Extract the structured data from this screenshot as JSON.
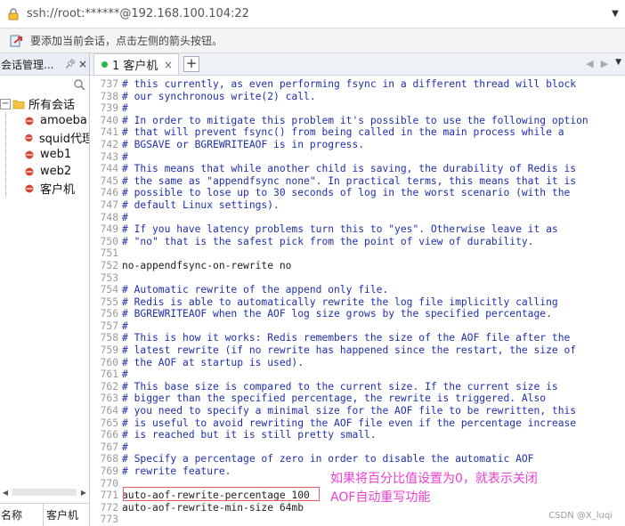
{
  "address_bar": {
    "text": "ssh://root:******@192.168.100.104:22",
    "dropdown_icon": "chevron-down-icon"
  },
  "hint_bar": {
    "text": "要添加当前会话，点击左侧的箭头按钮。"
  },
  "sidebar": {
    "title": "会话管理...",
    "pin_icon": "pin-icon",
    "close_icon": "close-icon",
    "root": {
      "toggle": "−",
      "label": "所有会话"
    },
    "items": [
      {
        "label": "amoeba"
      },
      {
        "label": "squid代理"
      },
      {
        "label": "web1"
      },
      {
        "label": "web2"
      },
      {
        "label": "客户机"
      }
    ],
    "footer": {
      "col1": "名称",
      "col2": "客户机"
    }
  },
  "tabs": [
    {
      "label": "1 客户机",
      "active": true
    }
  ],
  "tab_add": "+",
  "terminal": {
    "lines": [
      {
        "n": "737",
        "t": "# this currently, as even performing fsync in a different thread will block",
        "c": "comment"
      },
      {
        "n": "738",
        "t": "# our synchronous write(2) call.",
        "c": "comment"
      },
      {
        "n": "739",
        "t": "#",
        "c": "comment"
      },
      {
        "n": "740",
        "t": "# In order to mitigate this problem it's possible to use the following option",
        "c": "comment"
      },
      {
        "n": "741",
        "t": "# that will prevent fsync() from being called in the main process while a",
        "c": "comment"
      },
      {
        "n": "742",
        "t": "# BGSAVE or BGREWRITEAOF is in progress.",
        "c": "comment"
      },
      {
        "n": "743",
        "t": "#",
        "c": "comment"
      },
      {
        "n": "744",
        "t": "# This means that while another child is saving, the durability of Redis is",
        "c": "comment"
      },
      {
        "n": "745",
        "t": "# the same as \"appendfsync none\". In practical terms, this means that it is",
        "c": "comment"
      },
      {
        "n": "746",
        "t": "# possible to lose up to 30 seconds of log in the worst scenario (with the",
        "c": "comment"
      },
      {
        "n": "747",
        "t": "# default Linux settings).",
        "c": "comment"
      },
      {
        "n": "748",
        "t": "#",
        "c": "comment"
      },
      {
        "n": "749",
        "t": "# If you have latency problems turn this to \"yes\". Otherwise leave it as",
        "c": "comment"
      },
      {
        "n": "750",
        "t": "# \"no\" that is the safest pick from the point of view of durability.",
        "c": "comment"
      },
      {
        "n": "751",
        "t": "",
        "c": "code"
      },
      {
        "n": "752",
        "t": "no-appendfsync-on-rewrite no",
        "c": "code"
      },
      {
        "n": "753",
        "t": "",
        "c": "code"
      },
      {
        "n": "754",
        "t": "# Automatic rewrite of the append only file.",
        "c": "comment"
      },
      {
        "n": "755",
        "t": "# Redis is able to automatically rewrite the log file implicitly calling",
        "c": "comment"
      },
      {
        "n": "756",
        "t": "# BGREWRITEAOF when the AOF log size grows by the specified percentage.",
        "c": "comment"
      },
      {
        "n": "757",
        "t": "#",
        "c": "comment"
      },
      {
        "n": "758",
        "t": "# This is how it works: Redis remembers the size of the AOF file after the",
        "c": "comment"
      },
      {
        "n": "759",
        "t": "# latest rewrite (if no rewrite has happened since the restart, the size of",
        "c": "comment"
      },
      {
        "n": "760",
        "t": "# the AOF at startup is used).",
        "c": "comment"
      },
      {
        "n": "761",
        "t": "#",
        "c": "comment"
      },
      {
        "n": "762",
        "t": "# This base size is compared to the current size. If the current size is",
        "c": "comment"
      },
      {
        "n": "763",
        "t": "# bigger than the specified percentage, the rewrite is triggered. Also",
        "c": "comment"
      },
      {
        "n": "764",
        "t": "# you need to specify a minimal size for the AOF file to be rewritten, this",
        "c": "comment"
      },
      {
        "n": "765",
        "t": "# is useful to avoid rewriting the AOF file even if the percentage increase",
        "c": "comment"
      },
      {
        "n": "766",
        "t": "# is reached but it is still pretty small.",
        "c": "comment"
      },
      {
        "n": "767",
        "t": "#",
        "c": "comment"
      },
      {
        "n": "768",
        "t": "# Specify a percentage of zero in order to disable the automatic AOF",
        "c": "comment"
      },
      {
        "n": "769",
        "t": "# rewrite feature.",
        "c": "comment"
      },
      {
        "n": "770",
        "t": "",
        "c": "code"
      },
      {
        "n": "771",
        "t": "auto-aof-rewrite-percentage 100",
        "c": "code"
      },
      {
        "n": "772",
        "t": "auto-aof-rewrite-min-size 64mb",
        "c": "code"
      },
      {
        "n": "773",
        "t": "",
        "c": "code"
      }
    ]
  },
  "annotation": {
    "line1": "如果将百分比值设置为0，就表示关闭",
    "line2": "AOF自动重写功能",
    "color": "#ea3fd0"
  },
  "watermark": "CSDN @X_luqi"
}
